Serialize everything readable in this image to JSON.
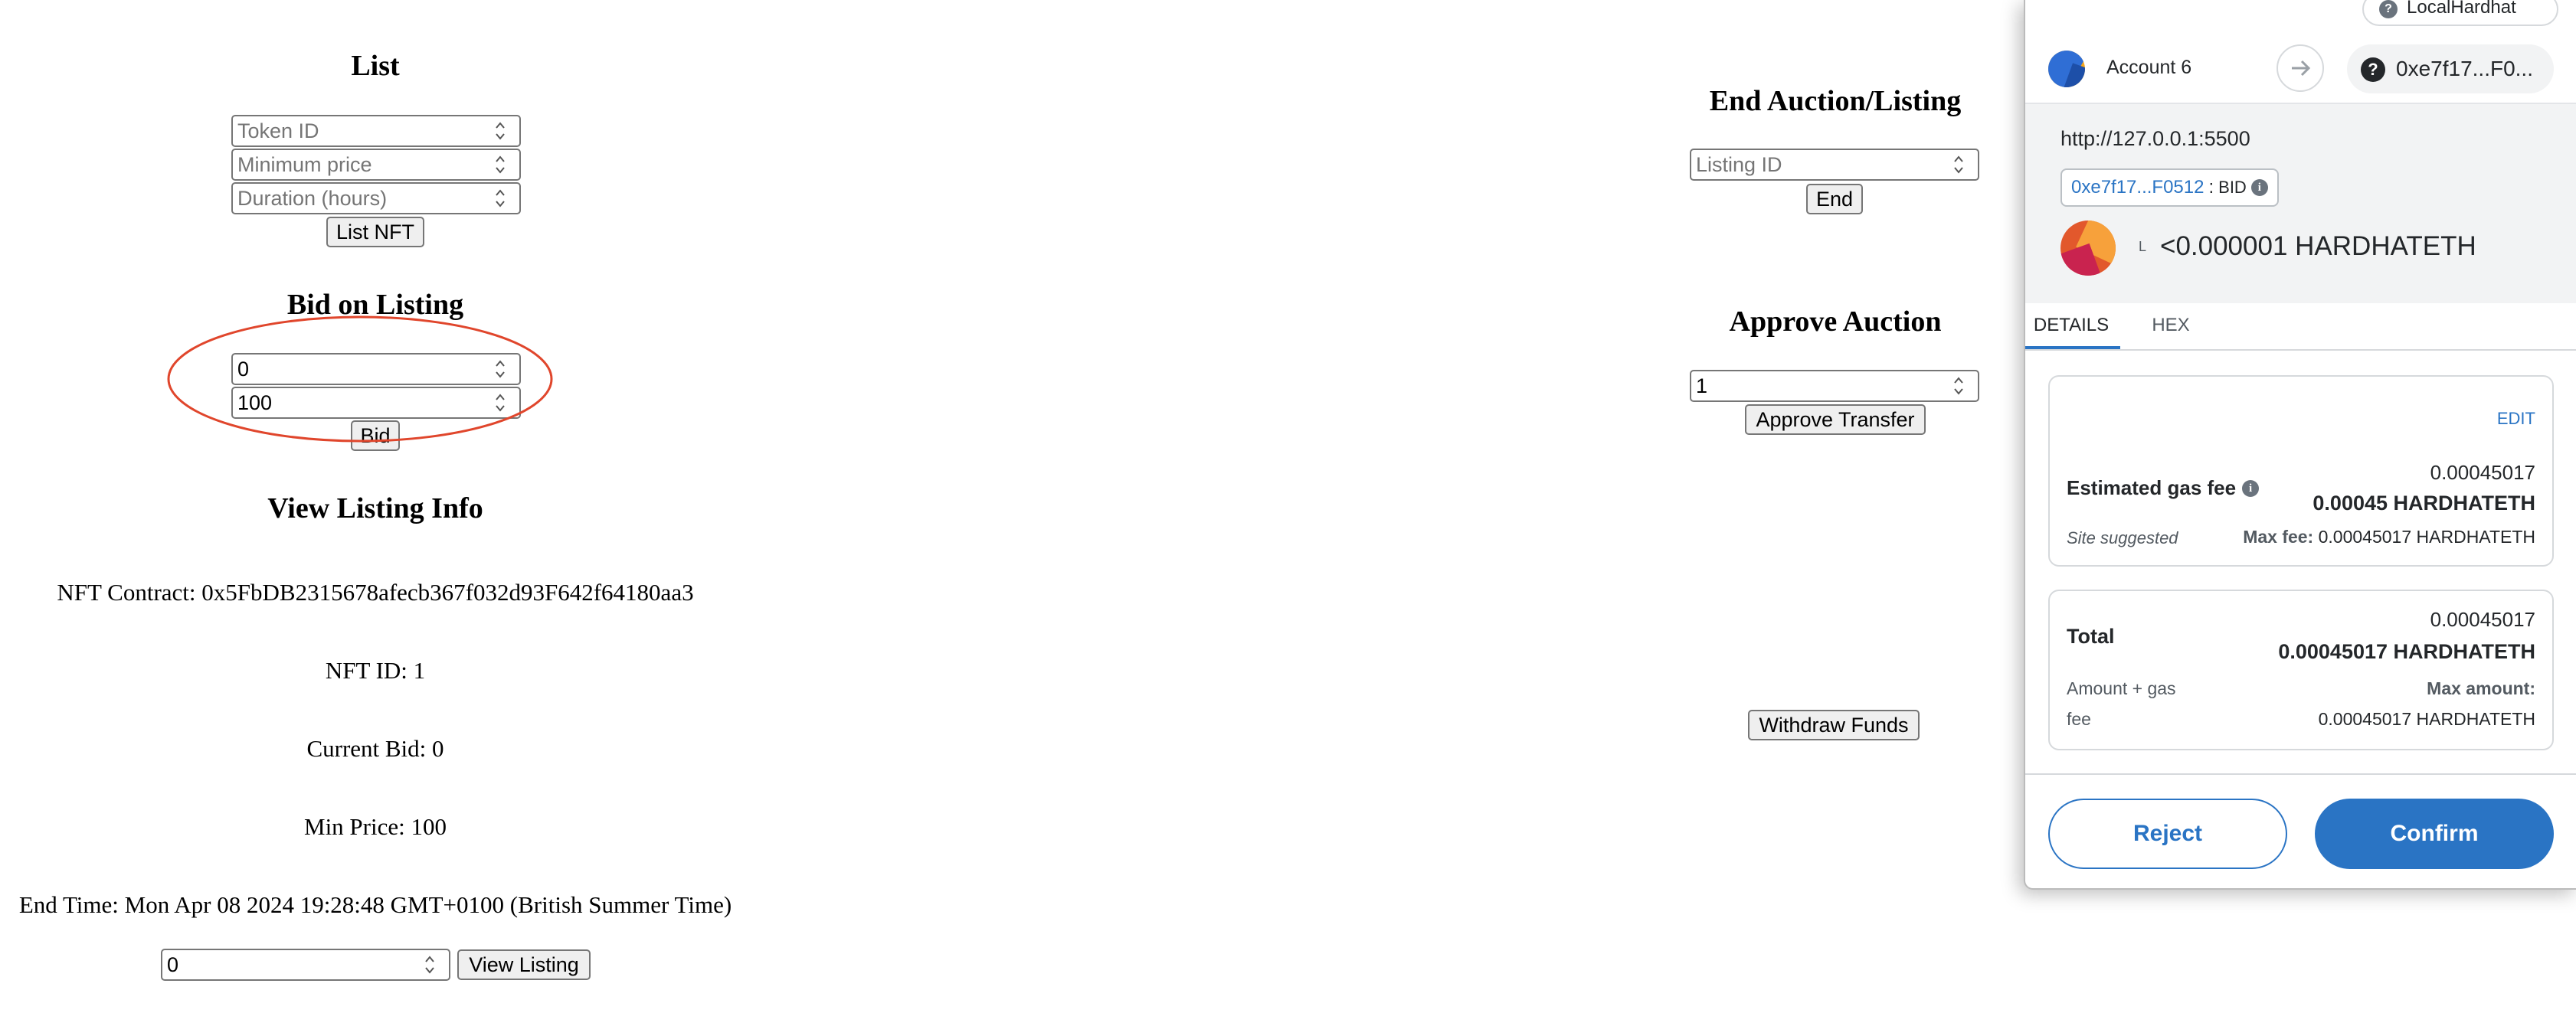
{
  "list": {
    "title": "List",
    "token_placeholder": "Token ID",
    "min_price_placeholder": "Minimum price",
    "duration_placeholder": "Duration (hours)",
    "button": "List NFT"
  },
  "bid": {
    "title": "Bid on Listing",
    "listing_value": "0",
    "amount_value": "100",
    "button": "Bid"
  },
  "view": {
    "title": "View Listing Info",
    "nft_contract": "NFT Contract: 0x5FbDB2315678afecb367f032d93F642f64180aa3",
    "nft_id": "NFT ID: 1",
    "current_bid": "Current Bid: 0",
    "min_price": "Min Price: 100",
    "end_time": "End Time: Mon Apr 08 2024 19:28:48 GMT+0100 (British Summer Time)",
    "listing_value": "0",
    "button": "View Listing"
  },
  "end": {
    "title": "End Auction/Listing",
    "placeholder": "Listing ID",
    "button": "End"
  },
  "approve": {
    "title": "Approve Auction",
    "value": "1",
    "button": "Approve Transfer"
  },
  "withdraw": {
    "button": "Withdraw Funds"
  },
  "metamask": {
    "network": "LocalHardhat",
    "account_name": "Account 6",
    "recipient": "0xe7f17...F0...",
    "origin": "http://127.0.0.1:5500",
    "contract_address": "0xe7f17...F0512",
    "method_sep": ":",
    "method": "BID",
    "token_letter": "L",
    "value": "<0.000001 HARDHATETH",
    "tabs": [
      "DETAILS",
      "HEX"
    ],
    "edit": "EDIT",
    "gas_label": "Estimated gas fee",
    "gas_value": "0.00045017",
    "gas_value_bold": "0.00045 HARDHATETH",
    "site_suggested": "Site suggested",
    "max_fee_label": "Max fee:",
    "max_fee_value": "0.00045017 HARDHATETH",
    "total_label": "Total",
    "total_value": "0.00045017",
    "total_value_bold": "0.00045017 HARDHATETH",
    "amount_gas_1": "Amount + gas",
    "amount_gas_2": "fee",
    "max_amount_label": "Max amount:",
    "max_amount_value": "0.00045017 HARDHATETH",
    "reject": "Reject",
    "confirm": "Confirm",
    "colors": {
      "accent": "#2a74c4",
      "annotation": "#e0462c"
    }
  }
}
